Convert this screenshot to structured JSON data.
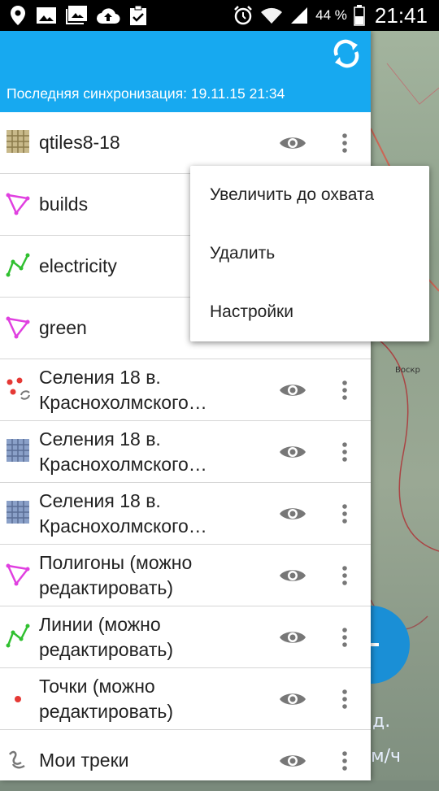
{
  "status_bar": {
    "battery": "44 %",
    "time": "21:41"
  },
  "header": {
    "sync_label": "Последняя синхронизация: 19.11.15 21:34"
  },
  "layers": [
    {
      "name": "qtiles8-18",
      "icon": "raster-tiles-icon"
    },
    {
      "name": "builds",
      "icon": "polygon-icon"
    },
    {
      "name": "electricity",
      "icon": "line-icon"
    },
    {
      "name": "green",
      "icon": "polygon-icon"
    },
    {
      "name": "Селения 18 в. Красно­холмского…",
      "line1": "Селения 18 в.",
      "line2": "Краснохолмского…",
      "icon": "points-sync-icon"
    },
    {
      "name": "Селения 18 в. Краснохолмского…",
      "line1": "Селения 18 в.",
      "line2": "Краснохолмского…",
      "icon": "raster-grid-icon"
    },
    {
      "name": "Селения 18 в. Краснохолмского…",
      "line1": "Селения 18 в.",
      "line2": "Краснохолмского…",
      "icon": "raster-grid-icon"
    },
    {
      "line1": "Полигоны (можно",
      "line2": "редактировать)",
      "icon": "polygon-icon"
    },
    {
      "line1": "Линии (можно",
      "line2": "редактировать)",
      "icon": "line-icon"
    },
    {
      "line1": "Точки (можно",
      "line2": "редактировать)",
      "icon": "point-icon"
    },
    {
      "name": "Мои треки",
      "icon": "track-icon"
    }
  ],
  "popup_menu": {
    "items": [
      "Увеличить до охвата",
      "Удалить",
      "Настройки"
    ]
  },
  "map": {
    "label_1": "Воскр",
    "d_label": "д.",
    "speed_label": "м/ч"
  },
  "colors": {
    "accent": "#17a9f0",
    "polygon": "#e040e0",
    "line": "#30c030",
    "point": "#e53935"
  }
}
